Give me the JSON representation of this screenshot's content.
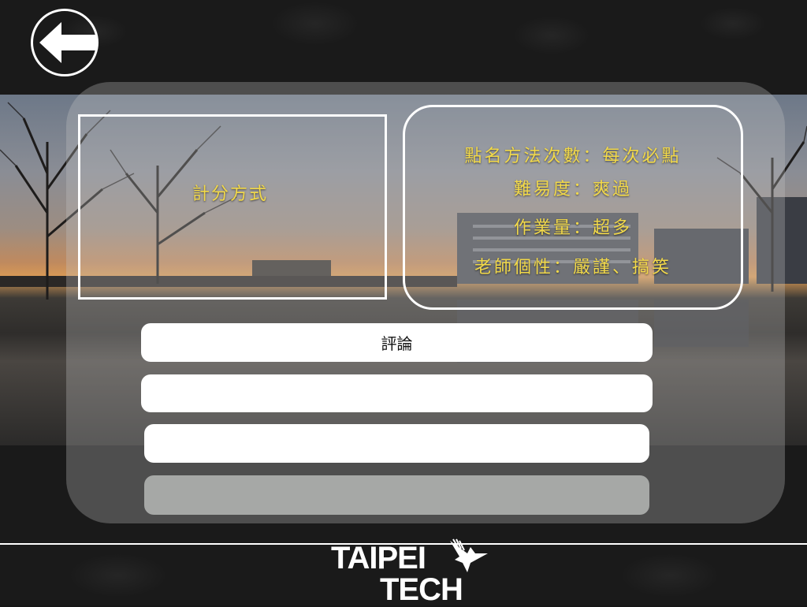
{
  "header": {
    "back_button_icon": "arrow-left-icon"
  },
  "course_card": {
    "grading_label": "計分方式",
    "info_lines": [
      "點名方法次數：每次必點",
      "難易度：爽過",
      "作業量：超多",
      "老師個性：嚴謹、搞笑"
    ]
  },
  "actions": {
    "comments_label": "評論"
  },
  "footer": {
    "logo_line1": "TAIPEI",
    "logo_line2": "TECH",
    "logo_icon": "eagle-icon"
  },
  "colors": {
    "accent_text": "#f2d94a",
    "panel": "rgba(200,200,200,0.30)",
    "bar_white": "#ffffff",
    "bar_gray": "#a6a8a6"
  }
}
